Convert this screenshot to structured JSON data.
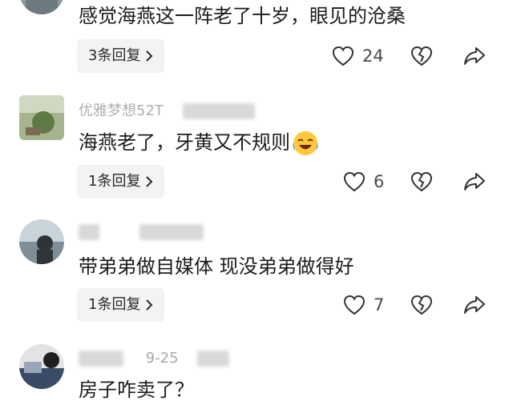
{
  "comments": [
    {
      "text": "感觉海燕这一阵老了十岁，眼见的沧桑",
      "reply_label": "3条回复",
      "likes": "24"
    },
    {
      "username": "优雅梦想52T",
      "text": "海燕老了，牙黄又不规则",
      "emoji": "laughing-crying-emoji",
      "reply_label": "1条回复",
      "likes": "6"
    },
    {
      "text": "带弟弟做自媒体 现没弟弟做得好",
      "reply_label": "1条回复",
      "likes": "7"
    },
    {
      "date": "9-25",
      "text": "房子咋卖了？"
    }
  ],
  "icons": {
    "like": "heart-outline-icon",
    "dislike": "broken-heart-icon",
    "share": "share-arrow-icon",
    "reply_chevron": "chevron-right-icon"
  },
  "colors": {
    "reply_bg": "#f2f3f4",
    "meta_text": "#9a9a9a",
    "icon_stroke": "#333333"
  }
}
